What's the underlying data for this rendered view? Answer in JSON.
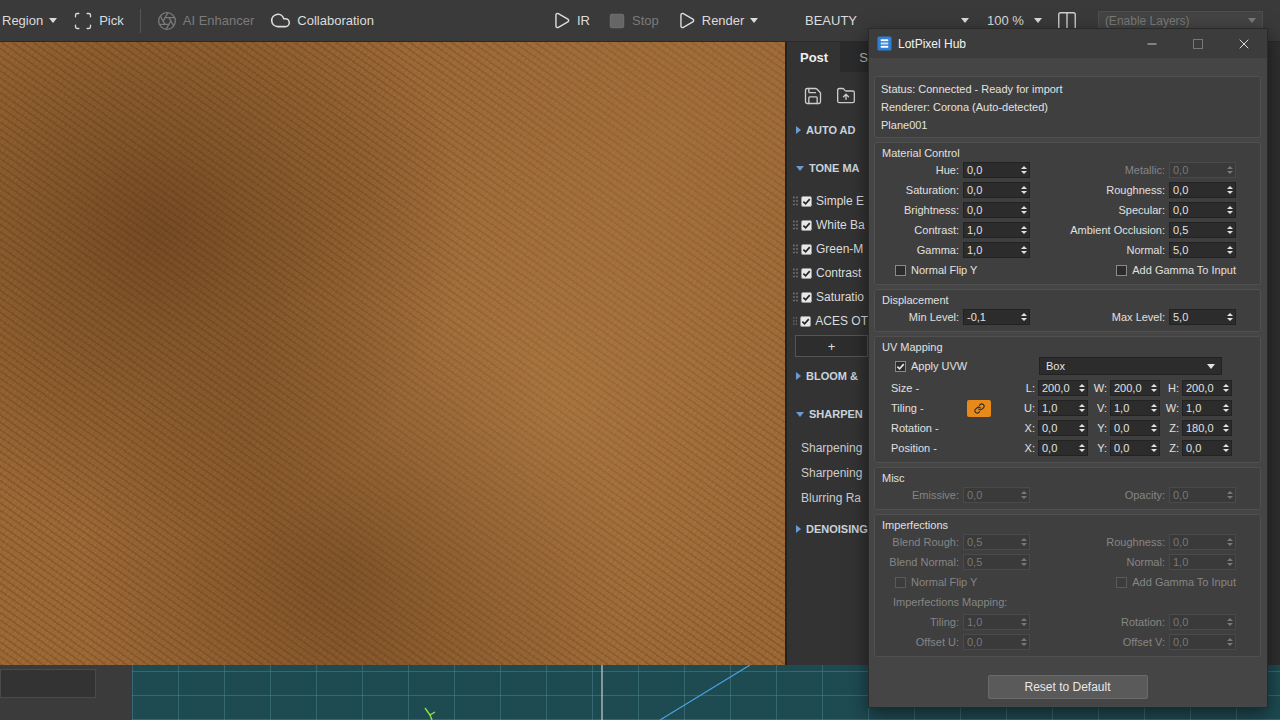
{
  "toolbar": {
    "tools": [
      {
        "label": "Region",
        "kind": "menu",
        "disabled": false
      },
      {
        "label": "Pick",
        "kind": "pick",
        "disabled": false
      },
      {
        "label": "AI Enhancer",
        "kind": "ai",
        "disabled": true
      },
      {
        "label": "Collaboration",
        "kind": "collab",
        "disabled": false
      }
    ],
    "render": [
      {
        "label": "IR",
        "kind": "play",
        "disabled": false
      },
      {
        "label": "Stop",
        "kind": "stop",
        "disabled": true
      },
      {
        "label": "Render",
        "kind": "render",
        "disabled": false
      }
    ],
    "pass": {
      "value": "BEAUTY"
    },
    "zoom": {
      "value": "100 %"
    },
    "layers": {
      "value": "(Enable Layers)",
      "disabled": true
    }
  },
  "post_panel": {
    "tabs": [
      {
        "label": "Post",
        "selected": true
      },
      {
        "label": "S",
        "selected": false
      }
    ],
    "sections": [
      {
        "title": "AUTO AD",
        "expanded": false,
        "kind": "collapsed"
      },
      {
        "title": "TONE MA",
        "expanded": true,
        "kind": "checklist",
        "items": [
          {
            "label": "Simple E",
            "checked": true
          },
          {
            "label": "White Ba",
            "checked": true
          },
          {
            "label": "Green-M",
            "checked": true
          },
          {
            "label": "Contrast",
            "checked": true
          },
          {
            "label": "Saturatio",
            "checked": true
          },
          {
            "label": "ACES OT",
            "checked": true
          }
        ],
        "add": "+"
      },
      {
        "title": "BLOOM &",
        "expanded": false,
        "kind": "collapsed"
      },
      {
        "title": "SHARPEN",
        "expanded": true,
        "kind": "params",
        "items": [
          {
            "label": "Sharpening"
          },
          {
            "label": "Sharpening"
          },
          {
            "label": "Blurring Ra"
          }
        ]
      },
      {
        "title": "DENOISING",
        "expanded": false,
        "kind": "collapsed"
      }
    ]
  },
  "window": {
    "title": "LotPixel Hub",
    "status": [
      "Status: Connected - Ready for import",
      "Renderer: Corona (Auto-detected)",
      "Plane001"
    ],
    "groups": [
      {
        "title": "Material Control",
        "rows": [
          {
            "kind": "pair",
            "left": {
              "label": "Hue:",
              "value": "0,0",
              "disabled": false
            },
            "right": {
              "label": "Metallic:",
              "value": "0,0",
              "disabled": true
            }
          },
          {
            "kind": "pair",
            "left": {
              "label": "Saturation:",
              "value": "0,0",
              "disabled": false
            },
            "right": {
              "label": "Roughness:",
              "value": "0,0",
              "disabled": false
            }
          },
          {
            "kind": "pair",
            "left": {
              "label": "Brightness:",
              "value": "0,0",
              "disabled": false
            },
            "right": {
              "label": "Specular:",
              "value": "0,0",
              "disabled": false
            }
          },
          {
            "kind": "pair",
            "left": {
              "label": "Contrast:",
              "value": "1,0",
              "disabled": false
            },
            "right": {
              "label": "Ambient Occlusion:",
              "value": "0,5",
              "disabled": false
            }
          },
          {
            "kind": "pair",
            "left": {
              "label": "Gamma:",
              "value": "1,0",
              "disabled": false
            },
            "right": {
              "label": "Normal:",
              "value": "5,0",
              "disabled": false
            }
          },
          {
            "kind": "checks",
            "left": {
              "label": "Normal Flip Y",
              "checked": false,
              "disabled": false
            },
            "right": {
              "label": "Add Gamma To Input",
              "checked": false,
              "disabled": false
            }
          }
        ]
      },
      {
        "title": "Displacement",
        "rows": [
          {
            "kind": "pair",
            "left": {
              "label": "Min Level:",
              "value": "-0,1",
              "disabled": false
            },
            "right": {
              "label": "Max Level:",
              "value": "5,0",
              "disabled": false
            }
          }
        ]
      },
      {
        "title": "UV Mapping",
        "rows": [
          {
            "kind": "apply",
            "check": {
              "label": "Apply UVW",
              "checked": true,
              "disabled": false
            },
            "select": {
              "value": "Box"
            }
          },
          {
            "kind": "axes",
            "label": "Size -",
            "axes": [
              {
                "label": "L:",
                "value": "200,0"
              },
              {
                "label": "W:",
                "value": "200,0"
              },
              {
                "label": "H:",
                "value": "200,0"
              }
            ]
          },
          {
            "kind": "axes",
            "label": "Tiling -",
            "lock": {
              "on": true
            },
            "axes": [
              {
                "label": "U:",
                "value": "1,0"
              },
              {
                "label": "V:",
                "value": "1,0"
              },
              {
                "label": "W:",
                "value": "1,0"
              }
            ]
          },
          {
            "kind": "axes",
            "label": "Rotation -",
            "axes": [
              {
                "label": "X:",
                "value": "0,0"
              },
              {
                "label": "Y:",
                "value": "0,0"
              },
              {
                "label": "Z:",
                "value": "180,0"
              }
            ]
          },
          {
            "kind": "axes",
            "label": "Position -",
            "axes": [
              {
                "label": "X:",
                "value": "0,0"
              },
              {
                "label": "Y:",
                "value": "0,0"
              },
              {
                "label": "Z:",
                "value": "0,0"
              }
            ]
          }
        ]
      },
      {
        "title": "Misc",
        "rows": [
          {
            "kind": "pair",
            "left": {
              "label": "Emissive:",
              "value": "0,0",
              "disabled": true
            },
            "right": {
              "label": "Opacity:",
              "value": "0,0",
              "disabled": true
            }
          }
        ]
      },
      {
        "title": "Imperfections",
        "rows": [
          {
            "kind": "pair",
            "left": {
              "label": "Blend Rough:",
              "value": "0,5",
              "disabled": true
            },
            "right": {
              "label": "Roughness:",
              "value": "0,0",
              "disabled": true
            }
          },
          {
            "kind": "pair",
            "left": {
              "label": "Blend Normal:",
              "value": "0,5",
              "disabled": true
            },
            "right": {
              "label": "Normal:",
              "value": "1,0",
              "disabled": true
            }
          },
          {
            "kind": "checks",
            "left": {
              "label": "Normal Flip Y",
              "checked": false,
              "disabled": true
            },
            "right": {
              "label": "Add Gamma To Input",
              "checked": false,
              "disabled": true
            }
          },
          {
            "kind": "note",
            "label": "Imperfections Mapping:",
            "disabled": true
          },
          {
            "kind": "pair",
            "left": {
              "label": "Tiling:",
              "value": "1,0",
              "disabled": true
            },
            "right": {
              "label": "Rotation:",
              "value": "0,0",
              "disabled": true
            }
          },
          {
            "kind": "pair",
            "left": {
              "label": "Offset U:",
              "value": "0,0",
              "disabled": true
            },
            "right": {
              "label": "Offset V:",
              "value": "0,0",
              "disabled": true
            }
          }
        ]
      }
    ],
    "button": "Reset to Default"
  }
}
